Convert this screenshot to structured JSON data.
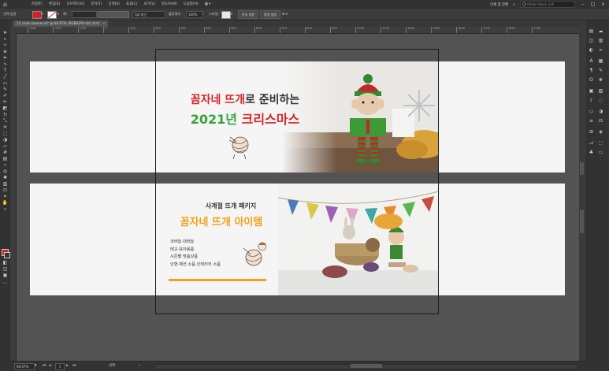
{
  "menubar": {
    "items": [
      "파일(F)",
      "편집(E)",
      "오브젝트(O)",
      "문자(T)",
      "선택(S)",
      "효과(C)",
      "보기(V)",
      "윈도우(W)",
      "도움말(H)"
    ],
    "workspace_label": "단체 및 분배",
    "search_placeholder": "Adobe Stock 검색"
  },
  "controlbar": {
    "selection_label": "선택 없음",
    "stroke_label": "획:",
    "brush_label": "5pt 둥근",
    "opacity_label": "불투명도:",
    "opacity_value": "100%",
    "style_label": "스타일:",
    "doc_setup_button": "문서 설정",
    "prefs_button": "환경 설정",
    "fill_color": "#d61f26"
  },
  "tab": {
    "title": "13_main banner.ai* @ 66.67% (RGB/GPU 미리 보기)"
  },
  "ruler": {
    "ticks": [
      "-300",
      "-200",
      "-100",
      "0",
      "100",
      "200",
      "300",
      "400",
      "500",
      "600",
      "700",
      "800",
      "900",
      "1000",
      "1100",
      "1200",
      "1300",
      "1400",
      "1500",
      "1600",
      "1700"
    ]
  },
  "banner1": {
    "line1_red": "꼼자네 뜨개",
    "line1_dark": "로 준비하는",
    "line2_green": "2021년",
    "line2_red": "크리스마스",
    "red": "#d6262c",
    "green": "#3aa13f",
    "dark": "#333333"
  },
  "banner2": {
    "kicker": "사계절 뜨개 패키지",
    "title": "꼼자네 뜨개 아이템",
    "items": [
      "코바늘·대바늘",
      "태교·육아용품",
      "시즌별 맞춤상품",
      "인형·패션 소품·인테리어 소품"
    ],
    "orange": "#f0a21a"
  },
  "statusbar": {
    "zoom": "66.67%",
    "artboard_num": "1",
    "tool_label": "선택"
  }
}
